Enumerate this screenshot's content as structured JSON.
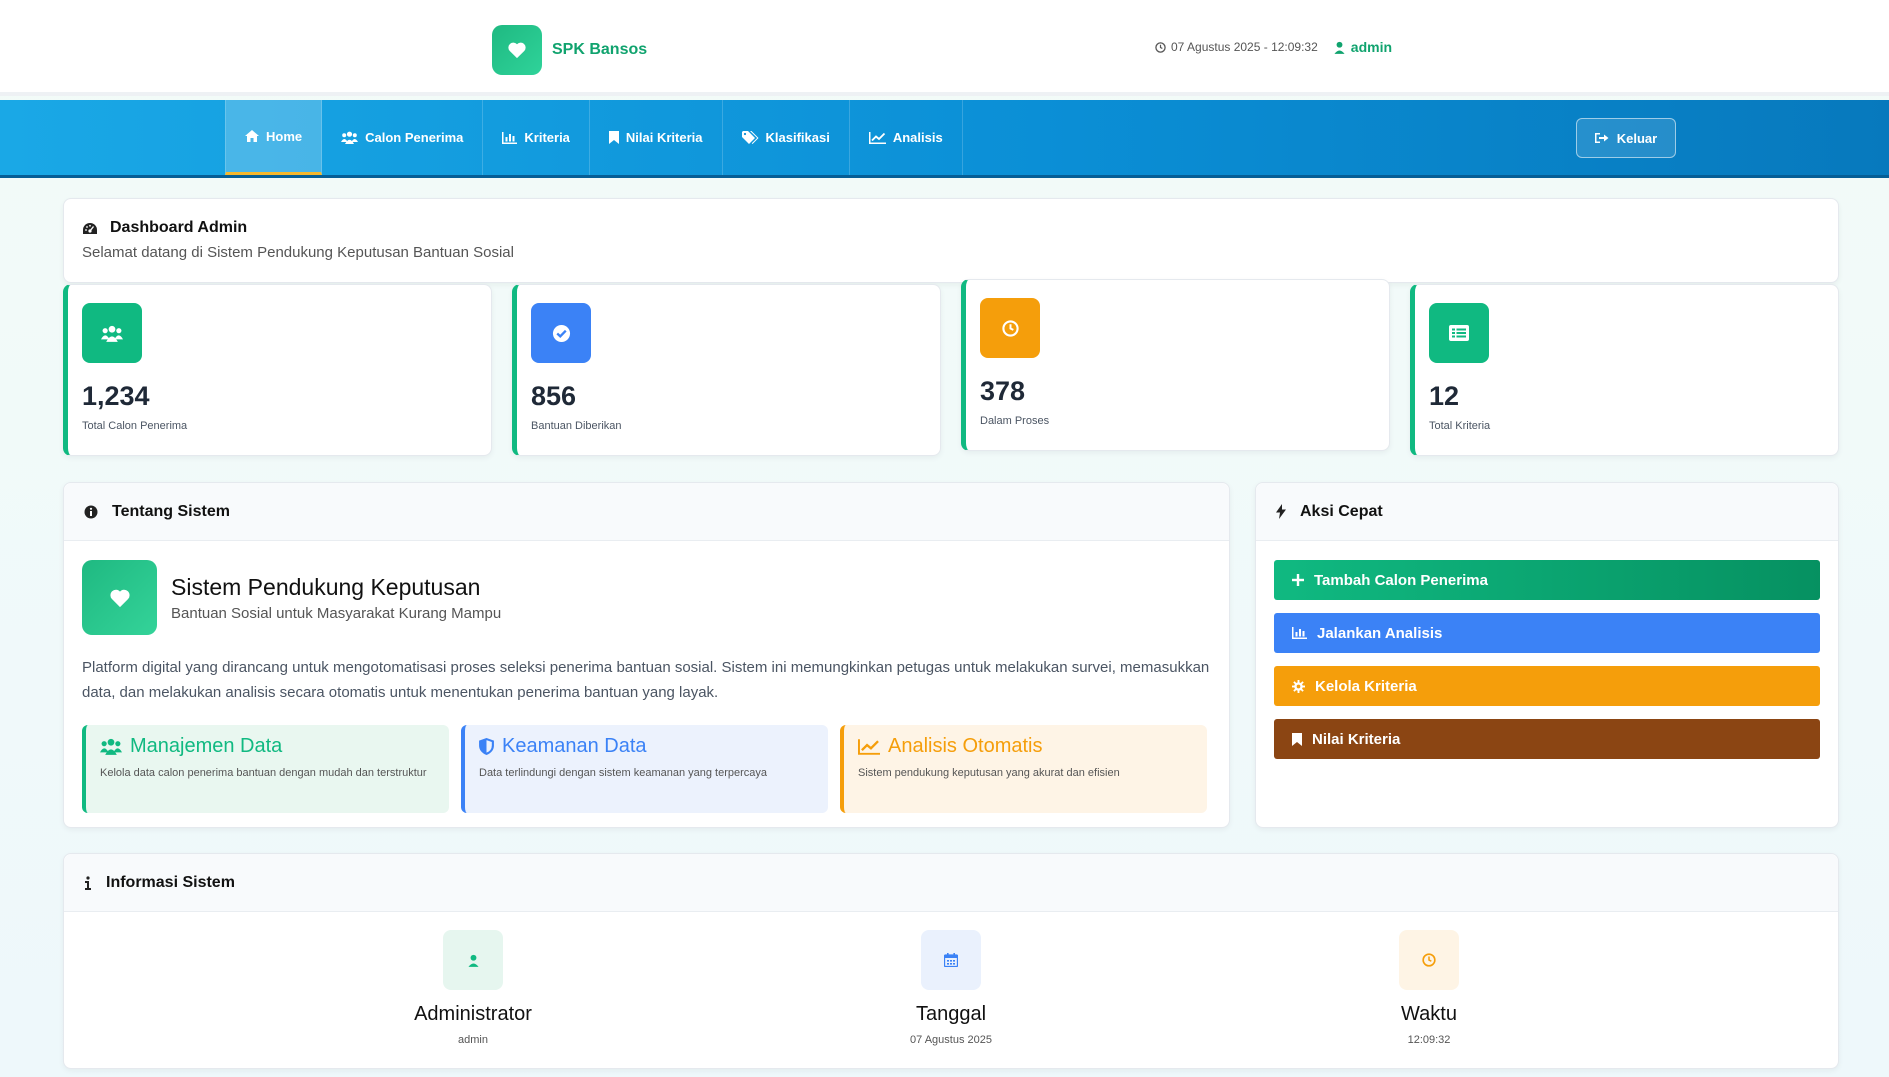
{
  "header": {
    "brand": "SPK Bansos",
    "datetime": "07 Agustus 2025 - 12:09:32",
    "user": "admin",
    "icons": {
      "brand": "heart-icon",
      "clock": "clock-icon",
      "user": "user-icon"
    }
  },
  "nav": {
    "items": [
      {
        "label": "Home",
        "icon": "home-icon",
        "active": true
      },
      {
        "label": "Calon Penerima",
        "icon": "users-icon",
        "active": false
      },
      {
        "label": "Kriteria",
        "icon": "bar-chart-icon",
        "active": false
      },
      {
        "label": "Nilai Kriteria",
        "icon": "bookmark-icon",
        "active": false
      },
      {
        "label": "Klasifikasi",
        "icon": "tags-icon",
        "active": false
      },
      {
        "label": "Analisis",
        "icon": "line-chart-icon",
        "active": false
      }
    ],
    "logout": "Keluar"
  },
  "dashboard": {
    "title": "Dashboard Admin",
    "subtitle": "Selamat datang di Sistem Pendukung Keputusan Bantuan Sosial"
  },
  "stats": [
    {
      "value": "1,234",
      "label": "Total Calon Penerima",
      "color": "#10b981",
      "icon": "users-icon"
    },
    {
      "value": "856",
      "label": "Bantuan Diberikan",
      "color": "#3b82f6",
      "icon": "check-circle-icon"
    },
    {
      "value": "378",
      "label": "Dalam Proses",
      "color": "#f59e0b",
      "icon": "clock-icon"
    },
    {
      "value": "12",
      "label": "Total Kriteria",
      "color": "#10b981",
      "icon": "list-icon"
    }
  ],
  "about": {
    "heading": "Tentang Sistem",
    "title": "Sistem Pendukung Keputusan",
    "tagline": "Bantuan Sosial untuk Masyarakat Kurang Mampu",
    "description": "Platform digital yang dirancang untuk mengotomatisasi proses seleksi penerima bantuan sosial. Sistem ini memungkinkan petugas untuk melakukan survei, memasukkan data, dan melakukan analisis secara otomatis untuk menentukan penerima bantuan yang layak.",
    "features": [
      {
        "title": "Manajemen Data",
        "text": "Kelola data calon penerima bantuan dengan mudah dan terstruktur",
        "color": "#10b981",
        "bg": "#e9f7f0"
      },
      {
        "title": "Keamanan Data",
        "text": "Data terlindungi dengan sistem keamanan yang terpercaya",
        "color": "#3b82f6",
        "bg": "#ecf2fd"
      },
      {
        "title": "Analisis Otomatis",
        "text": "Sistem pendukung keputusan yang akurat dan efisien",
        "color": "#f59e0b",
        "bg": "#fef4e6"
      }
    ]
  },
  "quick": {
    "heading": "Aksi Cepat",
    "actions": [
      {
        "label": "Tambah Calon Penerima",
        "color": "#0faa72",
        "icon": "plus-icon"
      },
      {
        "label": "Jalankan Analisis",
        "color": "#3b82f6",
        "icon": "bar-chart-icon"
      },
      {
        "label": "Kelola Kriteria",
        "color": "#f59e0b",
        "icon": "gear-icon"
      },
      {
        "label": "Nilai Kriteria",
        "color": "#8b4513",
        "icon": "bookmark-icon"
      }
    ]
  },
  "info": {
    "heading": "Informasi Sistem",
    "items": [
      {
        "title": "Administrator",
        "value": "admin",
        "color": "#10b981",
        "bg": "#e6f6ef",
        "icon": "user-icon"
      },
      {
        "title": "Tanggal",
        "value": "07 Agustus 2025",
        "color": "#3b82f6",
        "bg": "#eaf1fd",
        "icon": "calendar-icon"
      },
      {
        "title": "Waktu",
        "value": "12:09:32",
        "color": "#f59e0b",
        "bg": "#fef4e5",
        "icon": "clock-icon"
      }
    ]
  }
}
